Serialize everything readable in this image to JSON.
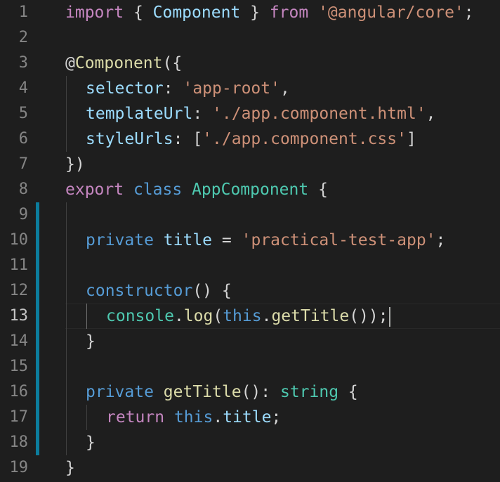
{
  "editor": {
    "active_line": 13,
    "line_numbers": [
      "1",
      "2",
      "3",
      "4",
      "5",
      "6",
      "7",
      "8",
      "9",
      "10",
      "11",
      "12",
      "13",
      "14",
      "15",
      "16",
      "17",
      "18",
      "19"
    ],
    "code": {
      "l1": {
        "t1": "import",
        "t2": " { ",
        "t3": "Component",
        "t4": " } ",
        "t5": "from",
        "t6": " ",
        "t7": "'@angular/core'",
        "t8": ";"
      },
      "l3": {
        "t1": "@",
        "t2": "Component",
        "t3": "({"
      },
      "l4": {
        "t1": "selector",
        "t2": ": ",
        "t3": "'app-root'",
        "t4": ","
      },
      "l5": {
        "t1": "templateUrl",
        "t2": ": ",
        "t3": "'./app.component.html'",
        "t4": ","
      },
      "l6": {
        "t1": "styleUrls",
        "t2": ": [",
        "t3": "'./app.component.css'",
        "t4": "]"
      },
      "l7": {
        "t1": "})"
      },
      "l8": {
        "t1": "export",
        "t2": " ",
        "t3": "class",
        "t4": " ",
        "t5": "AppComponent",
        "t6": " {"
      },
      "l10": {
        "t1": "private",
        "t2": " ",
        "t3": "title",
        "t4": " = ",
        "t5": "'practical-test-app'",
        "t6": ";"
      },
      "l12": {
        "t1": "constructor",
        "t2": "() {"
      },
      "l13": {
        "t1": "console",
        "t2": ".",
        "t3": "log",
        "t4": "(",
        "t5": "this",
        "t6": ".",
        "t7": "getTitle",
        "t8": "());"
      },
      "l14": {
        "t1": "}"
      },
      "l16": {
        "t1": "private",
        "t2": " ",
        "t3": "getTitle",
        "t4": "(): ",
        "t5": "string",
        "t6": " {"
      },
      "l17": {
        "t1": "return",
        "t2": " ",
        "t3": "this",
        "t4": ".",
        "t5": "title",
        "t6": ";"
      },
      "l18": {
        "t1": "}"
      },
      "l19": {
        "t1": "}"
      }
    },
    "colors": {
      "background": "#1e1e1e",
      "keyword_control": "#c586c0",
      "keyword_storage": "#569cd6",
      "variable": "#9cdcfe",
      "type": "#4ec9b0",
      "string": "#ce9178",
      "function": "#dcdcaa",
      "punctuation": "#d4d4d4",
      "line_number": "#858585",
      "modified_bar": "#0c7d9d"
    }
  }
}
